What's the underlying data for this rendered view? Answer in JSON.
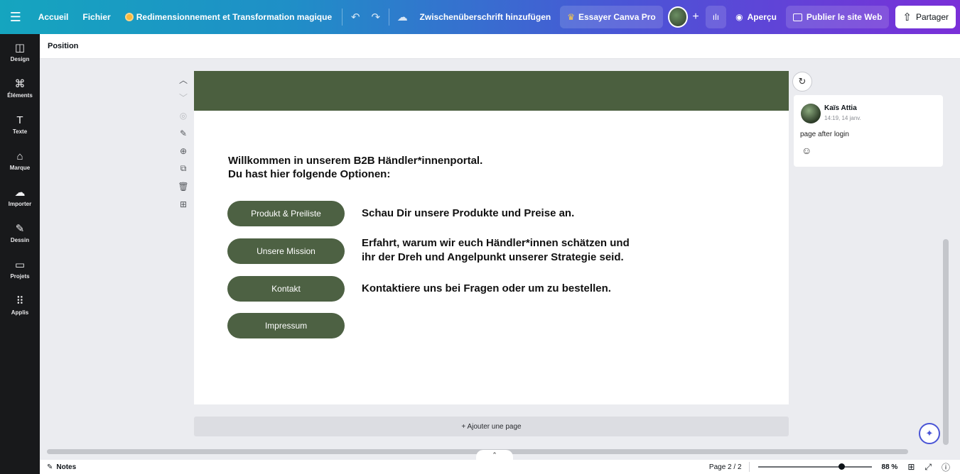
{
  "topbar": {
    "home": "Accueil",
    "file": "Fichier",
    "resize": "Redimensionnement et Transformation magique",
    "doc_title": "Zwischenüberschrift hinzufügen",
    "try_pro": "Essayer Canva Pro",
    "preview": "Aperçu",
    "publish": "Publier le site Web",
    "share": "Partager"
  },
  "rail": [
    {
      "label": "Design",
      "icon": "design-icon",
      "glyph": "◫"
    },
    {
      "label": "Éléments",
      "icon": "elements-icon",
      "glyph": "⌘"
    },
    {
      "label": "Texte",
      "icon": "text-icon",
      "glyph": "T"
    },
    {
      "label": "Marque",
      "icon": "brand-icon",
      "glyph": "⌂"
    },
    {
      "label": "Importer",
      "icon": "upload-icon",
      "glyph": "☁"
    },
    {
      "label": "Dessin",
      "icon": "draw-icon",
      "glyph": "✎"
    },
    {
      "label": "Projets",
      "icon": "folder-icon",
      "glyph": "▭"
    },
    {
      "label": "Applis",
      "icon": "apps-icon",
      "glyph": "⠿"
    }
  ],
  "context_bar": {
    "position": "Position"
  },
  "design": {
    "welcome_line1": "Willkommen in unserem B2B Händler*innenportal.",
    "welcome_line2": "Du hast hier folgende Optionen:",
    "buttons": [
      "Produkt & Preiliste",
      "Unsere Mission",
      "Kontakt",
      "Impressum"
    ],
    "descriptions": {
      "products": "Schau Dir unsere Produkte und Preise an.",
      "mission_line1": "Erfahrt, warum wir euch Händler*innen schätzen und",
      "mission_line2": "ihr der Dreh und Angelpunkt unserer Strategie seid.",
      "contact": "Kontaktiere uns bei Fragen oder um zu bestellen."
    },
    "header_color": "#4b5f3f",
    "button_color": "#4d6143"
  },
  "add_page": "+ Ajouter une page",
  "comment": {
    "author": "Kaïs Attia",
    "time": "14:19, 14 janv.",
    "text": "page after login"
  },
  "footer": {
    "notes": "Notes",
    "page": "Page 2 / 2",
    "zoom": "88 %",
    "zoom_level": 0.88
  }
}
